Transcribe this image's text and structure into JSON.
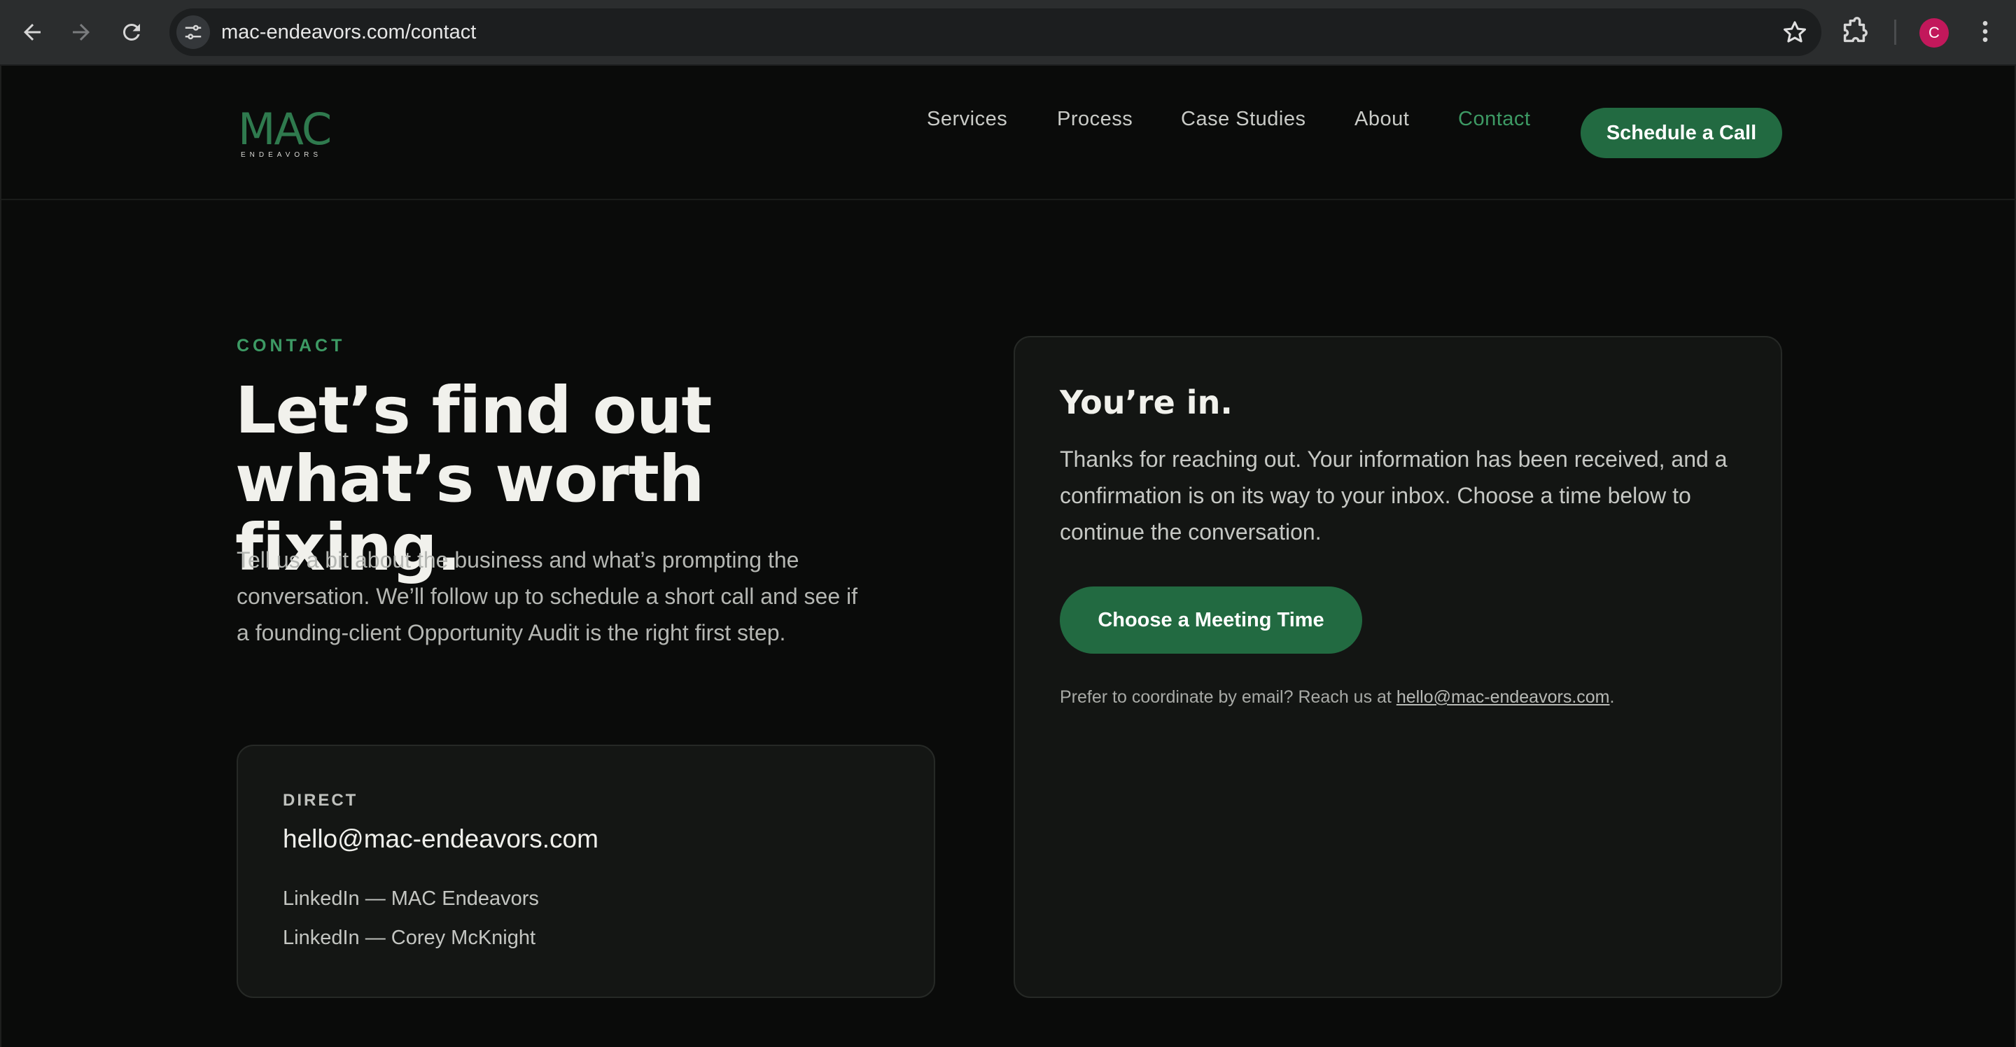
{
  "browser": {
    "url": "mac-endeavors.com/contact",
    "profile_initial": "C",
    "profile_color": "#c2185b"
  },
  "brand": {
    "logo_text": "MAC",
    "logo_subtext": "ENDEAVORS",
    "accent_color": "#2f7a4e",
    "button_color": "#226a41"
  },
  "nav": {
    "items": [
      {
        "label": "Services"
      },
      {
        "label": "Process"
      },
      {
        "label": "Case Studies"
      },
      {
        "label": "About"
      },
      {
        "label": "Contact",
        "active": true
      }
    ],
    "cta_label": "Schedule a Call"
  },
  "contact": {
    "eyebrow": "CONTACT",
    "headline_line1": "Let’s find out",
    "headline_line2": "what’s worth fixing.",
    "lede": "Tell us a bit about the business and what’s prompting the conversation. We’ll follow up to schedule a short call and see if a founding-client Opportunity Audit is the right first step."
  },
  "direct": {
    "label": "DIRECT",
    "email": "hello@mac-endeavors.com",
    "links": [
      {
        "label": "LinkedIn — MAC Endeavors"
      },
      {
        "label": "LinkedIn — Corey McKnight"
      }
    ]
  },
  "confirmation": {
    "title": "You’re in.",
    "body": "Thanks for reaching out. Your information has been received, and a confirmation is on its way to your inbox. Choose a time below to continue the conversation.",
    "button_label": "Choose a Meeting Time",
    "email_note_prefix": "Prefer to coordinate by email? Reach us at ",
    "email_note_link": "hello@mac-endeavors.com",
    "email_note_suffix": "."
  }
}
